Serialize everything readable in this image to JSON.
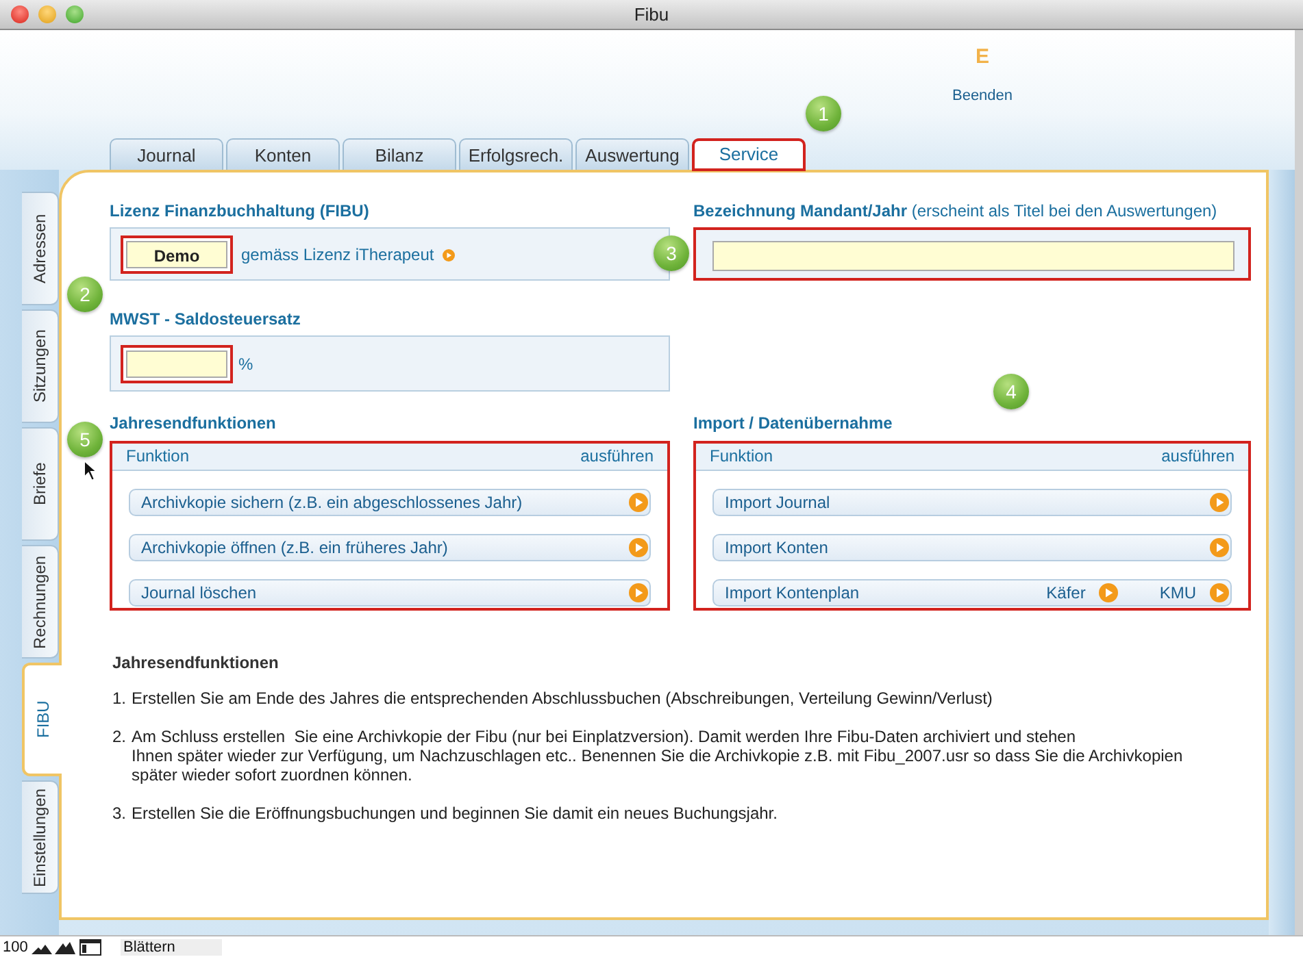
{
  "window": {
    "title": "Fibu"
  },
  "header": {
    "logo": "E",
    "quit_link": "Beenden"
  },
  "tabs": [
    {
      "label": "Journal",
      "selected": false
    },
    {
      "label": "Konten",
      "selected": false
    },
    {
      "label": "Bilanz",
      "selected": false
    },
    {
      "label": "Erfolgsrech.",
      "selected": false
    },
    {
      "label": "Auswertung",
      "selected": false
    },
    {
      "label": "Service",
      "selected": true
    }
  ],
  "side_tabs": [
    {
      "label": "Adressen",
      "selected": false
    },
    {
      "label": "Sitzungen",
      "selected": false
    },
    {
      "label": "Briefe",
      "selected": false
    },
    {
      "label": "Rechnungen",
      "selected": false
    },
    {
      "label": "FIBU",
      "selected": true
    },
    {
      "label": "Einstellungen",
      "selected": false
    }
  ],
  "license": {
    "heading": "Lizenz Finanzbuchhaltung (FIBU)",
    "value": "Demo",
    "link": "gemäss Lizenz iTherapeut"
  },
  "client": {
    "heading": "**Bezeichnung Mandant/Jahr** (erscheint als Titel bei den Auswertungen)"
  },
  "vat": {
    "heading": "MWST - Saldosteuersatz",
    "unit": "%"
  },
  "year_end": {
    "heading": "Jahresendfunktionen",
    "column_1": "Funktion",
    "column_2": "ausführen",
    "rows": [
      {
        "label": "Archivkopie sichern (z.B. ein abgeschlossenes Jahr)"
      },
      {
        "label": "Archivkopie öffnen (z.B. ein früheres Jahr)"
      },
      {
        "label": "Journal löschen"
      }
    ]
  },
  "import": {
    "heading": "Import / Datenübernahme",
    "column_1": "Funktion",
    "column_2": "ausführen",
    "rows": [
      {
        "label": "Import Journal"
      },
      {
        "label": "Import Konten"
      },
      {
        "label": "Import Kontenplan",
        "options": [
          "Käfer",
          "KMU"
        ]
      }
    ]
  },
  "notes": {
    "heading": "Jahresendfunktionen",
    "items": [
      {
        "number": "1.",
        "text": "Erstellen Sie am Ende des Jahres die entsprechenden Abschlussbuchen (Abschreibungen, Verteilung Gewinn/Verlust)"
      },
      {
        "number": "2.",
        "text": "Am Schluss erstellen  Sie eine Archivkopie der Fibu (nur bei Einplatzversion). Damit werden Ihre Fibu-Daten archiviert und stehen\nIhnen später wieder zur Verfügung, um Nachzuschlagen etc.. Benennen Sie die Archivkopie z.B. mit Fibu_2007.usr so dass Sie die Archivkopien\nspäter wieder sofort zuordnen können."
      },
      {
        "number": "3.",
        "text": "Erstellen Sie die Eröffnungsbuchungen und beginnen Sie damit ein neues Buchungsjahr."
      }
    ]
  },
  "callouts": [
    "1",
    "2",
    "3",
    "4",
    "5"
  ],
  "status_bar": {
    "zoom": "100",
    "mode": "Blättern"
  }
}
